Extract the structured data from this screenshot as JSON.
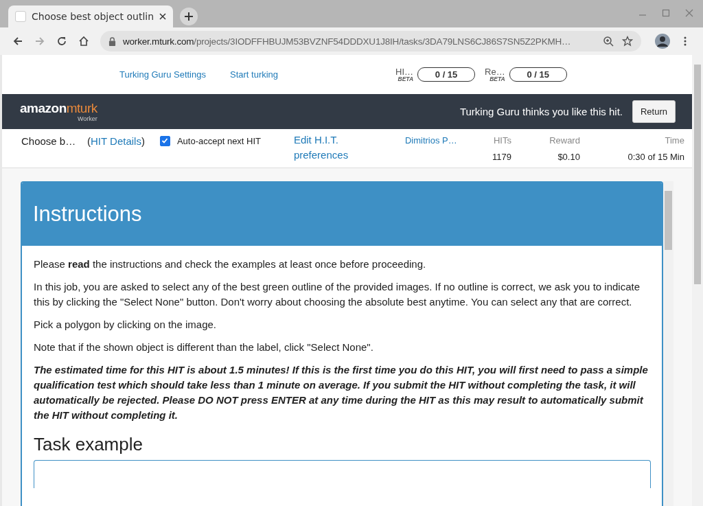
{
  "browser": {
    "tab_title": "Choose best object outlin",
    "address_domain": "worker.mturk.com",
    "address_path": "/projects/3IODFFHBUJM53BVZNF54DDDXU1J8IH/tasks/3DA79LNS6CJ86S7SN5Z2PKMH…"
  },
  "header": {
    "links": [
      "Turking Guru Settings",
      "Start turking"
    ],
    "counters": [
      {
        "label": "HI…",
        "badge": "BETA",
        "value": "0 / 15"
      },
      {
        "label": "Re…",
        "badge": "BETA",
        "value": "0 / 15"
      }
    ]
  },
  "banner": {
    "logo_left": "amazon",
    "logo_right": "mturk",
    "logo_sub": "Worker",
    "message": "Turking Guru thinks you like this hit.",
    "button": "Return"
  },
  "hit_bar": {
    "title": "Choose b…",
    "paren_open": "(",
    "details_link": "HIT Details",
    "paren_close": ")",
    "auto_accept": {
      "label": "Auto-accept next HIT",
      "checked": true
    },
    "preferences_link": "Edit H.I.T. preferences",
    "requester": "Dimitrios P…",
    "stats": [
      {
        "label": "HITs",
        "value": "1179"
      },
      {
        "label": "Reward",
        "value": "$0.10"
      },
      {
        "label": "Time",
        "value": "0:30 of 15 Min"
      }
    ]
  },
  "instructions": {
    "heading": "Instructions",
    "paragraphs": [
      {
        "kind": "normal",
        "text": "Please **read** the instructions and check the examples at least once before proceeding."
      },
      {
        "kind": "normal",
        "text": "In this job, you are asked to select any of the best green outline of the provided images. If no outline is correct, we ask you to indicate this by clicking the \"Select None\" button. Don't worry about choosing the absolute best anytime. You can select any that are correct."
      },
      {
        "kind": "normal",
        "text": "Pick a polygon by clicking on the image."
      },
      {
        "kind": "normal",
        "text": "Note that if the shown object is different than the label, click \"Select None\"."
      },
      {
        "kind": "warning",
        "text": "The estimated time for this HIT is about 1.5 minutes! If this is the first time you do this HIT, you will first need to pass a simple qualification test which should take less than 1 minute on average. If you submit the HIT without completing the task, it will automatically be rejected. Please DO NOT press ENTER at any time during the HIT as this may result to automatically submit the HIT without completing it."
      }
    ],
    "section_heading": "Task example"
  }
}
